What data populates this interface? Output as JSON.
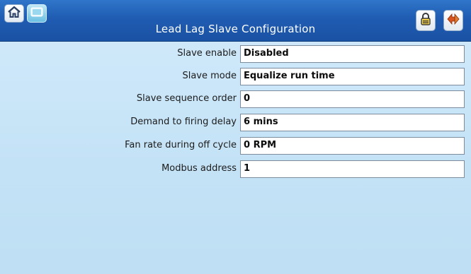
{
  "header": {
    "title": "Lead Lag Slave Configuration",
    "home_icon": "home-icon",
    "screen_icon": "screen-icon",
    "lock_icon": "lock-icon",
    "back_icon": "back-arrow-icon"
  },
  "settings": [
    {
      "label": "Slave enable",
      "value": "Disabled"
    },
    {
      "label": "Slave mode",
      "value": "Equalize run time"
    },
    {
      "label": "Slave sequence order",
      "value": "0"
    },
    {
      "label": "Demand to firing delay",
      "value": "6 mins"
    },
    {
      "label": "Fan rate during off cycle",
      "value": "0 RPM"
    },
    {
      "label": "Modbus address",
      "value": "1"
    }
  ],
  "colors": {
    "titlebar": "#1f5cb2",
    "background": "#c6e3f7"
  }
}
